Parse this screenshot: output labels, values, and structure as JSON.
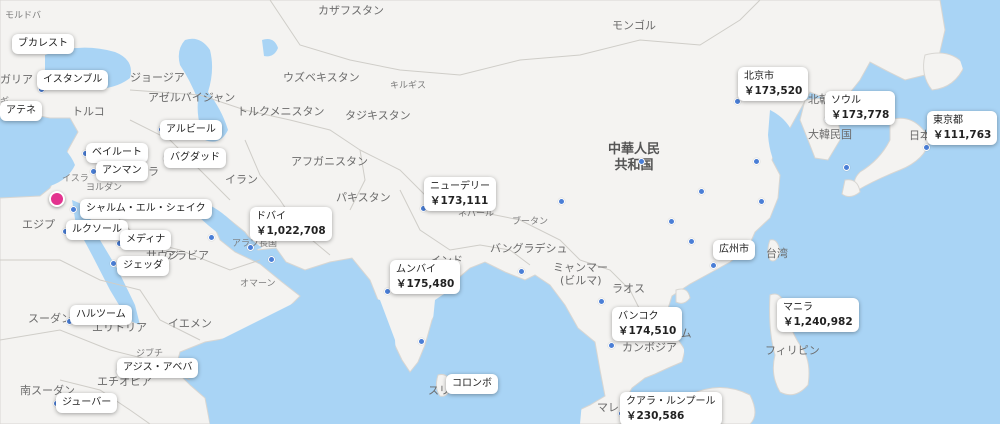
{
  "colors": {
    "sea": "#a9d4f5",
    "land": "#f4f3f1",
    "border": "#c9c9c9",
    "dot": "#4a7ed6",
    "marker": "#e3338f"
  },
  "labels": {
    "kazakhstan": "カザフスタン",
    "mongolia": "モンゴル",
    "moldova": "モルドバ",
    "bulgaria": "ガリア",
    "georgia": "ジョージア",
    "uzbekistan": "ウズベキスタン",
    "kyrgyz": "キルギス",
    "azerbaijan": "アゼルバイジャン",
    "turkmenistan": "トルクメニスタン",
    "tajikistan": "タジキスタン",
    "turkey": "トルコ",
    "afghanistan": "アフガニスタン",
    "china_1": "中華人民",
    "china_2": "共和国",
    "israel": "イスラ",
    "jordan": "ヨルダン",
    "iran": "イラン",
    "iraq": "ラ",
    "egypt": "エジプ",
    "pakistan": "パキスタン",
    "nepal": "ネパール",
    "bhutan": "ブータン",
    "bangladesh": "バングラデシュ",
    "india": "インド",
    "myanmar_1": "ミャンマー",
    "myanmar_2": "(ビルマ)",
    "laos": "ラオス",
    "taiwan": "台湾",
    "arabia": "アラビア",
    "oman": "オマーン",
    "uae": "アラブ長国",
    "sudan": "スーダン",
    "eritrea": "エリトリア",
    "yemen": "イエメン",
    "djibouti": "ジブチ",
    "ethiopia": "エチオピア",
    "south_sudan": "南スーダン",
    "cambodia": "カンボジア",
    "vietnam": "ナム",
    "philippines": "フィリピン",
    "srilanka": "スリ",
    "malaysia": "マレ",
    "korea_n": "北朝",
    "korea_s": "大韓民国",
    "japan": "日本",
    "greece": "ギ",
    "saudi": "サウジ"
  },
  "pins": {
    "bucharest": {
      "name": "ブカレスト"
    },
    "istanbul": {
      "name": "イスタンブル"
    },
    "athens": {
      "name": "アテネ"
    },
    "erbil": {
      "name": "アルビール"
    },
    "baghdad": {
      "name": "バグダッド"
    },
    "beirut": {
      "name": "ベイルート"
    },
    "amman": {
      "name": "アンマン"
    },
    "sharm": {
      "name": "シャルム・エル・シェイク"
    },
    "luxor": {
      "name": "ルクソール"
    },
    "medina": {
      "name": "メディナ"
    },
    "jeddah": {
      "name": "ジェッダ"
    },
    "khartoum": {
      "name": "ハルツーム"
    },
    "addis": {
      "name": "アジス・アベバ"
    },
    "juba": {
      "name": "ジューバー"
    },
    "dubai": {
      "name": "ドバイ",
      "price": "￥1,022,708"
    },
    "newdelhi": {
      "name": "ニューデリー",
      "price": "￥173,111"
    },
    "mumbai": {
      "name": "ムンバイ",
      "price": "￥175,480"
    },
    "colombo": {
      "name": "コロンボ"
    },
    "beijing": {
      "name": "北京市",
      "price": "￥173,520"
    },
    "seoul": {
      "name": "ソウル",
      "price": "￥173,778"
    },
    "tokyo": {
      "name": "東京都",
      "price": "￥111,763"
    },
    "guangzhou": {
      "name": "広州市"
    },
    "bangkok": {
      "name": "バンコク",
      "price": "￥174,510"
    },
    "manila": {
      "name": "マニラ",
      "price": "￥1,240,982"
    },
    "kl": {
      "name": "クアラ・ルンプール",
      "price": "￥230,586"
    }
  }
}
